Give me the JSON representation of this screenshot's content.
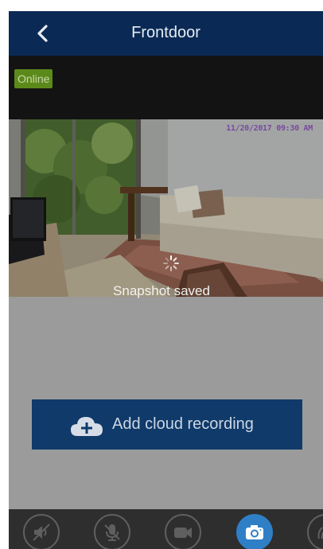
{
  "header": {
    "title": "Frontdoor",
    "back_icon": "chevron-left-icon"
  },
  "status": {
    "online_label": "Online",
    "online_color": "#5c8a1a"
  },
  "video": {
    "timestamp": "11/20/2017 09:30 AM",
    "loading": true
  },
  "toast": {
    "message": "Snapshot saved"
  },
  "cloud": {
    "button_label": "Add cloud recording",
    "icon": "cloud-add-icon"
  },
  "toolbar": {
    "buttons": [
      {
        "name": "mute-speaker-button",
        "icon": "speaker-muted-icon",
        "active": false
      },
      {
        "name": "mute-mic-button",
        "icon": "microphone-muted-icon",
        "active": false
      },
      {
        "name": "record-video-button",
        "icon": "video-camera-icon",
        "active": false
      },
      {
        "name": "snapshot-button",
        "icon": "camera-icon",
        "active": true
      },
      {
        "name": "talk-button",
        "icon": "intercom-icon",
        "active": false
      }
    ]
  },
  "colors": {
    "header_bg": "#0a2a55",
    "accent": "#2f7fc6",
    "cloud_button_bg": "#0f3a6a"
  }
}
